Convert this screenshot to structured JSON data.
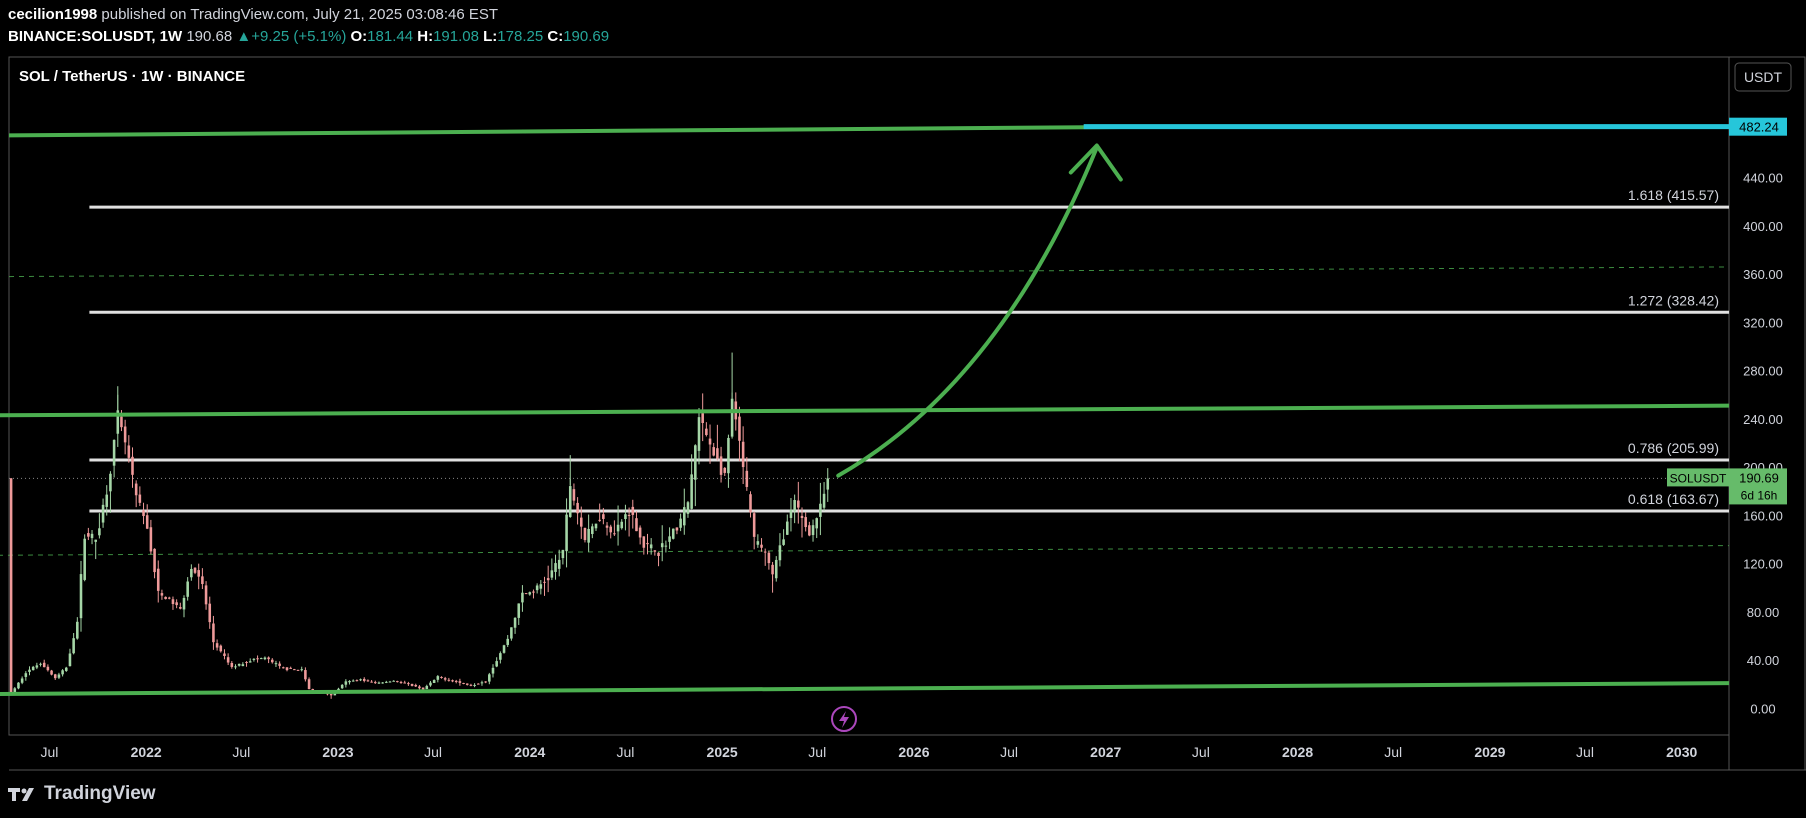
{
  "header": {
    "author": "cecilion1998",
    "published_text": "published on TradingView.com, July 21, 2025 03:08:46 EST",
    "symbol": "BINANCE:SOLUSDT, 1W",
    "last": "190.68",
    "change": "+9.25 (+5.1%)",
    "open_label": "O:",
    "open": "181.44",
    "high_label": "H:",
    "high": "191.08",
    "low_label": "L:",
    "low": "178.25",
    "close_label": "C:",
    "close": "190.69"
  },
  "footer": {
    "brand": "TradingView"
  },
  "colors": {
    "up": "#26a69a",
    "down": "#ef5350",
    "candle_up": "#a5d6a7",
    "candle_down": "#ef9a9a",
    "trend": "#4caf50",
    "fib": "#e0e0e0",
    "target": "#26c6da",
    "axis_text": "#d1d4dc",
    "price_tag": "#66bb6a",
    "lightning": "#ab47bc"
  },
  "chart_data": {
    "type": "candlestick",
    "title": "SOL / TetherUS · 1W · BINANCE",
    "currency": "USDT",
    "ylim": [
      -22,
      540
    ],
    "xlim": [
      "2021-04-15",
      "2030-04-01"
    ],
    "y_ticks": [
      "0.00",
      "40.00",
      "80.00",
      "120.00",
      "160.00",
      "200.00",
      "240.00",
      "280.00",
      "320.00",
      "360.00",
      "400.00",
      "440.00"
    ],
    "x_ticks": [
      {
        "t": "2021-07-01",
        "label": "Jul",
        "bold": false
      },
      {
        "t": "2022-01-01",
        "label": "2022",
        "bold": true
      },
      {
        "t": "2022-07-01",
        "label": "Jul",
        "bold": false
      },
      {
        "t": "2023-01-01",
        "label": "2023",
        "bold": true
      },
      {
        "t": "2023-07-01",
        "label": "Jul",
        "bold": false
      },
      {
        "t": "2024-01-01",
        "label": "2024",
        "bold": true
      },
      {
        "t": "2024-07-01",
        "label": "Jul",
        "bold": false
      },
      {
        "t": "2025-01-01",
        "label": "2025",
        "bold": true
      },
      {
        "t": "2025-07-01",
        "label": "Jul",
        "bold": false
      },
      {
        "t": "2026-01-01",
        "label": "2026",
        "bold": true
      },
      {
        "t": "2026-07-01",
        "label": "Jul",
        "bold": false
      },
      {
        "t": "2027-01-01",
        "label": "2027",
        "bold": true
      },
      {
        "t": "2027-07-01",
        "label": "Jul",
        "bold": false
      },
      {
        "t": "2028-01-01",
        "label": "2028",
        "bold": true
      },
      {
        "t": "2028-07-01",
        "label": "Jul",
        "bold": false
      },
      {
        "t": "2029-01-01",
        "label": "2029",
        "bold": true
      },
      {
        "t": "2029-07-01",
        "label": "Jul",
        "bold": false
      },
      {
        "t": "2030-01-01",
        "label": "2030",
        "bold": true
      }
    ],
    "price_path": [
      [
        "2021-04-19",
        12
      ],
      [
        "2021-05-17",
        30
      ],
      [
        "2021-06-14",
        38
      ],
      [
        "2021-07-12",
        25
      ],
      [
        "2021-08-02",
        34
      ],
      [
        "2021-08-23",
        72
      ],
      [
        "2021-09-06",
        145
      ],
      [
        "2021-09-27",
        140
      ],
      [
        "2021-10-18",
        180
      ],
      [
        "2021-11-08",
        240
      ],
      [
        "2021-11-22",
        220
      ],
      [
        "2021-12-13",
        175
      ],
      [
        "2022-01-03",
        150
      ],
      [
        "2022-01-24",
        95
      ],
      [
        "2022-02-14",
        90
      ],
      [
        "2022-03-07",
        82
      ],
      [
        "2022-03-28",
        118
      ],
      [
        "2022-04-18",
        102
      ],
      [
        "2022-05-09",
        55
      ],
      [
        "2022-06-13",
        34
      ],
      [
        "2022-07-18",
        40
      ],
      [
        "2022-08-15",
        42
      ],
      [
        "2022-09-19",
        33
      ],
      [
        "2022-10-24",
        32
      ],
      [
        "2022-11-07",
        16
      ],
      [
        "2022-12-19",
        11
      ],
      [
        "2023-01-16",
        22
      ],
      [
        "2023-02-13",
        24
      ],
      [
        "2023-03-13",
        21
      ],
      [
        "2023-04-17",
        23
      ],
      [
        "2023-05-15",
        20
      ],
      [
        "2023-06-12",
        16
      ],
      [
        "2023-07-10",
        26
      ],
      [
        "2023-08-14",
        22
      ],
      [
        "2023-09-11",
        19
      ],
      [
        "2023-10-09",
        23
      ],
      [
        "2023-10-30",
        40
      ],
      [
        "2023-11-20",
        58
      ],
      [
        "2023-12-18",
        95
      ],
      [
        "2024-01-08",
        97
      ],
      [
        "2024-02-05",
        108
      ],
      [
        "2024-03-04",
        130
      ],
      [
        "2024-03-18",
        185
      ],
      [
        "2024-04-15",
        140
      ],
      [
        "2024-05-13",
        160
      ],
      [
        "2024-06-10",
        145
      ],
      [
        "2024-07-08",
        165
      ],
      [
        "2024-08-05",
        135
      ],
      [
        "2024-09-02",
        130
      ],
      [
        "2024-10-07",
        150
      ],
      [
        "2024-10-28",
        170
      ],
      [
        "2024-11-18",
        240
      ],
      [
        "2024-12-09",
        220
      ],
      [
        "2025-01-06",
        190
      ],
      [
        "2025-01-20",
        255
      ],
      [
        "2025-02-10",
        200
      ],
      [
        "2025-03-03",
        140
      ],
      [
        "2025-03-24",
        130
      ],
      [
        "2025-04-07",
        110
      ],
      [
        "2025-04-28",
        145
      ],
      [
        "2025-05-19",
        170
      ],
      [
        "2025-06-16",
        145
      ],
      [
        "2025-07-07",
        165
      ],
      [
        "2025-07-21",
        190.69
      ]
    ],
    "wick_spikes": [
      [
        "2021-11-08",
        260
      ],
      [
        "2024-03-18",
        210
      ],
      [
        "2025-01-20",
        295
      ],
      [
        "2025-04-07",
        96
      ],
      [
        "2022-12-19",
        8
      ]
    ],
    "trendlines": [
      {
        "name": "upper-resistance",
        "from": [
          "2021-04-15",
          475
        ],
        "to": [
          "2027-02-01",
          482
        ]
      },
      {
        "name": "mid-resistance",
        "from": [
          "2021-03-25",
          243
        ],
        "to": [
          "2030-04-01",
          251
        ]
      },
      {
        "name": "lower-support",
        "from": [
          "2021-03-25",
          12
        ],
        "to": [
          "2030-04-01",
          21
        ]
      }
    ],
    "dashed_lines": [
      {
        "from": [
          "2021-04-15",
          358
        ],
        "to": [
          "2030-04-01",
          366
        ]
      },
      {
        "from": [
          "2021-03-25",
          127
        ],
        "to": [
          "2030-04-01",
          135
        ]
      }
    ],
    "fib_levels": [
      {
        "label": "1.618 (415.57)",
        "value": 415.57,
        "start": "2021-09-15"
      },
      {
        "label": "1.272 (328.42)",
        "value": 328.42,
        "start": "2021-09-15"
      },
      {
        "label": "0.786 (205.99)",
        "value": 205.99,
        "start": "2021-09-15"
      },
      {
        "label": "0.618 (163.67)",
        "value": 163.67,
        "start": "2021-09-15"
      }
    ],
    "target": {
      "value": 482.24,
      "label": "482.24",
      "start": "2026-11-20"
    },
    "arrow_path": [
      [
        "2025-08-10",
        193
      ],
      [
        "2026-06-15",
        270
      ],
      [
        "2026-12-15",
        465
      ]
    ],
    "current": {
      "symbol": "SOLUSDT",
      "value": 190.69,
      "price_label": "190.69",
      "countdown": "6d 16h"
    },
    "last_date": "2025-07-21"
  }
}
